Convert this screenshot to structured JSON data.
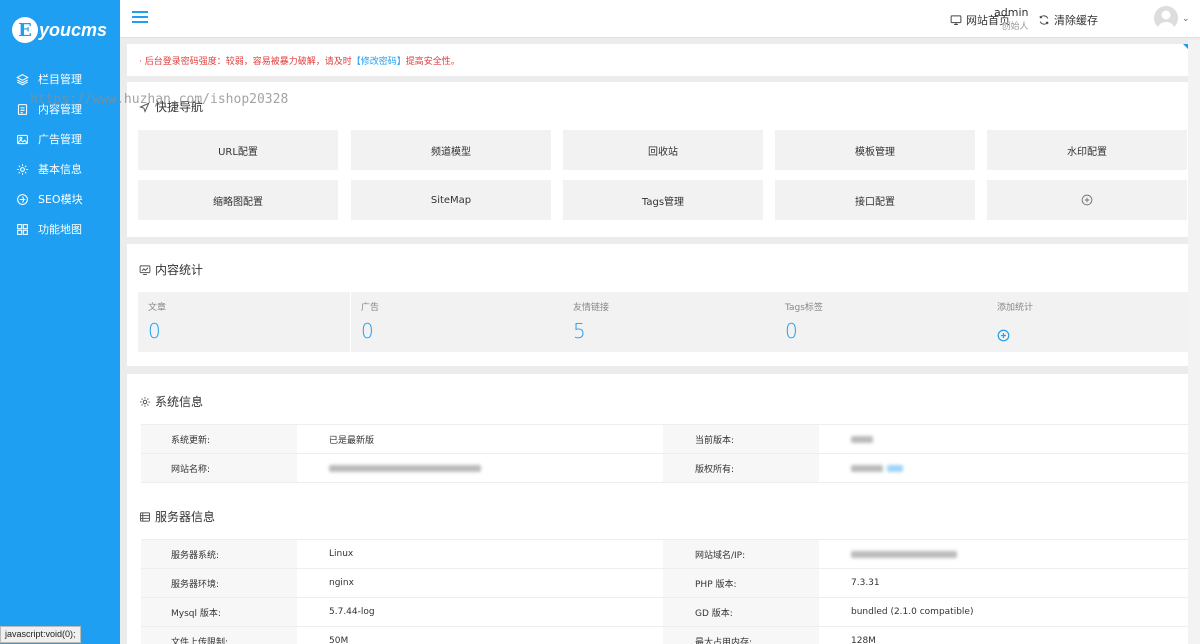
{
  "app": {
    "logo_letter": "E",
    "logo_text": "youcms",
    "accent": "#1e9ff2"
  },
  "sidebar": {
    "items": [
      {
        "label": "栏目管理",
        "icon": "layers-icon"
      },
      {
        "label": "内容管理",
        "icon": "document-icon"
      },
      {
        "label": "广告管理",
        "icon": "image-icon"
      },
      {
        "label": "基本信息",
        "icon": "gear-icon"
      },
      {
        "label": "SEO模块",
        "icon": "seo-icon"
      },
      {
        "label": "功能地图",
        "icon": "grid-icon"
      }
    ]
  },
  "topbar": {
    "home_label": "网站首页",
    "clear_cache_label": "清除缓存",
    "user_name": "admin",
    "user_role": "创始人"
  },
  "alert": {
    "text": "· 后台登录密码强度：较弱，容易被暴力破解，请及时",
    "link": "【修改密码】",
    "suffix": "提高安全性。"
  },
  "quick_nav": {
    "title": "快捷导航",
    "items": [
      "URL配置",
      "频道模型",
      "回收站",
      "模板管理",
      "水印配置",
      "缩略图配置",
      "SiteMap",
      "Tags管理",
      "接口配置"
    ]
  },
  "stats": {
    "title": "内容统计",
    "items": [
      {
        "label": "文章",
        "value": "0"
      },
      {
        "label": "广告",
        "value": "0"
      },
      {
        "label": "友情链接",
        "value": "5"
      },
      {
        "label": "Tags标签",
        "value": "0"
      }
    ],
    "add_label": "添加统计"
  },
  "system_info": {
    "title": "系统信息",
    "rows": [
      {
        "k1": "系统更新:",
        "v1": "已是最新版",
        "k2": "当前版本:",
        "v2": ""
      },
      {
        "k1": "网站名称:",
        "v1": "",
        "k2": "版权所有:",
        "v2": ""
      }
    ]
  },
  "server_info": {
    "title": "服务器信息",
    "rows": [
      {
        "k1": "服务器系统:",
        "v1": "Linux",
        "k2": "网站域名/IP:",
        "v2": ""
      },
      {
        "k1": "服务器环境:",
        "v1": "nginx",
        "k2": "PHP 版本:",
        "v2": "7.3.31"
      },
      {
        "k1": "Mysql 版本:",
        "v1": "5.7.44-log",
        "k2": "GD 版本:",
        "v2": "bundled (2.1.0 compatible)"
      },
      {
        "k1": "文件上传限制:",
        "v1": "50M",
        "k2": "最大占用内存:",
        "v2": "128M"
      }
    ]
  },
  "watermark": "https://www.huzhan.com/ishop20328",
  "statusbar": "javascript:void(0);"
}
